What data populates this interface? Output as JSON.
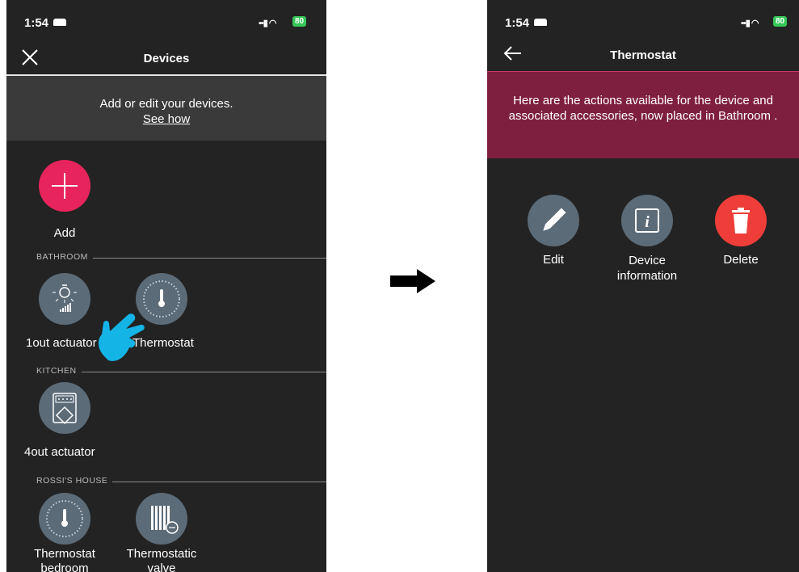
{
  "left": {
    "time": "1:54",
    "battery": "80",
    "title": "Devices",
    "banner_line1": "Add or edit your devices.",
    "banner_link": "See how",
    "add_label": "Add",
    "sections": {
      "bathroom": "BATHROOM",
      "kitchen": "KITCHEN",
      "rossis": "ROSSI'S HOUSE"
    },
    "devices": {
      "out1": "1out actuator",
      "thermostat": "Thermostat",
      "out4": "4out actuator",
      "thermo_bedroom_line1": "Thermostat",
      "thermo_bedroom_line2": "bedroom",
      "valve_line1": "Thermostatic",
      "valve_line2": "valve"
    }
  },
  "right": {
    "time": "1:54",
    "battery": "80",
    "title": "Thermostat",
    "banner": "Here are the actions available for the device and associated accessories, now placed in Bathroom .",
    "actions": {
      "edit": "Edit",
      "info_line1": "Device",
      "info_line2": "information",
      "delete": "Delete"
    }
  },
  "colors": {
    "background": "#232323",
    "add_accent": "#e8245c",
    "banner_red": "#7f1f3f",
    "delete_red": "#ef3e3a",
    "device_circle": "#5b6b78",
    "hand_cyan": "#14b4e6"
  }
}
